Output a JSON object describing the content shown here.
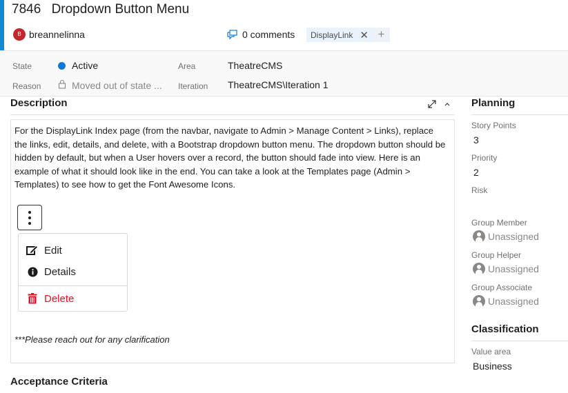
{
  "work_item": {
    "id": "7846",
    "title": "Dropdown Button Menu",
    "assignee": "breannelinna",
    "assignee_initial": "B",
    "comments_label": "0 comments",
    "tags": [
      "DisplayLink"
    ],
    "add_tag_label": "+"
  },
  "fields": {
    "state_label": "State",
    "state_value": "Active",
    "reason_label": "Reason",
    "reason_value": "Moved out of state ...",
    "area_label": "Area",
    "area_value": "TheatreCMS",
    "iteration_label": "Iteration",
    "iteration_value": "TheatreCMS\\Iteration 1"
  },
  "description": {
    "heading": "Description",
    "paragraph": "For the DisplayLink Index page (from the navbar, navigate to Admin > Manage Content > Links), replace the links, edit, details, and delete, with a Bootstrap dropdown button menu.  The dropdown button should be hidden by default, but when a User hovers over a record, the button should fade into view.  Here is an example of what it should look like in the end.  You can take a look at the Templates page (Admin > Templates) to see how to get the Font Awesome Icons.",
    "menu_items": [
      {
        "label": "Edit",
        "icon": "edit-icon"
      },
      {
        "label": "Details",
        "icon": "info-circle-icon"
      },
      {
        "label": "Delete",
        "icon": "trash-icon"
      }
    ],
    "note": "***Please reach out for any clarification"
  },
  "acceptance_heading": "Acceptance Criteria",
  "planning": {
    "heading": "Planning",
    "story_points_label": "Story Points",
    "story_points_value": "3",
    "priority_label": "Priority",
    "priority_value": "2",
    "risk_label": "Risk",
    "risk_value": "",
    "group_member_label": "Group Member",
    "group_member_value": "Unassigned",
    "group_helper_label": "Group Helper",
    "group_helper_value": "Unassigned",
    "group_associate_label": "Group Associate",
    "group_associate_value": "Unassigned"
  },
  "classification": {
    "heading": "Classification",
    "value_area_label": "Value area",
    "value_area_value": "Business"
  },
  "colors": {
    "accent": "#0f8ad7",
    "state_active": "#0f78d4",
    "delete_red": "#e81123",
    "avatar": "#c4262e"
  }
}
